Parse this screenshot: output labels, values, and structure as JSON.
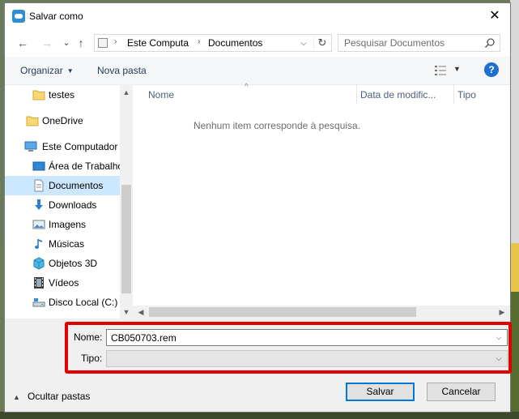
{
  "window": {
    "title": "Salvar como",
    "close_glyph": "✕"
  },
  "nav": {
    "back_glyph": "←",
    "forward_glyph": "→",
    "recent_glyph": "⌄",
    "up_glyph": "↑",
    "breadcrumb": [
      "Este Computa",
      "Documentos"
    ],
    "breadcrumb_sep": "›",
    "search_placeholder": "Pesquisar Documentos"
  },
  "toolbar": {
    "organize_label": "Organizar",
    "new_folder_label": "Nova pasta",
    "help_glyph": "?"
  },
  "sidebar": {
    "items": [
      {
        "label": "testes",
        "icon": "folder-icon"
      },
      {
        "label": "OneDrive",
        "icon": "folder-icon"
      },
      {
        "label": "Este Computador",
        "icon": "computer-icon"
      },
      {
        "label": "Área de Trabalho",
        "icon": "desktop-icon"
      },
      {
        "label": "Documentos",
        "icon": "documents-icon",
        "selected": true
      },
      {
        "label": "Downloads",
        "icon": "download-icon"
      },
      {
        "label": "Imagens",
        "icon": "pictures-icon"
      },
      {
        "label": "Músicas",
        "icon": "music-icon"
      },
      {
        "label": "Objetos 3D",
        "icon": "objects-3d-icon"
      },
      {
        "label": "Vídeos",
        "icon": "video-icon"
      },
      {
        "label": "Disco Local (C:)",
        "icon": "drive-icon"
      }
    ]
  },
  "files": {
    "columns": [
      "Nome",
      "Data de modific...",
      "Tipo"
    ],
    "empty_message": "Nenhum item corresponde à pesquisa."
  },
  "form": {
    "name_label": "Nome:",
    "name_value": "CB050703.rem",
    "type_label": "Tipo:",
    "type_value": ""
  },
  "footer": {
    "hide_folders_label": "Ocultar pastas",
    "save_label": "Salvar",
    "cancel_label": "Cancelar"
  },
  "colors": {
    "selection": "#cce8ff",
    "highlight_frame": "#e00000",
    "accent": "#0078d7"
  }
}
